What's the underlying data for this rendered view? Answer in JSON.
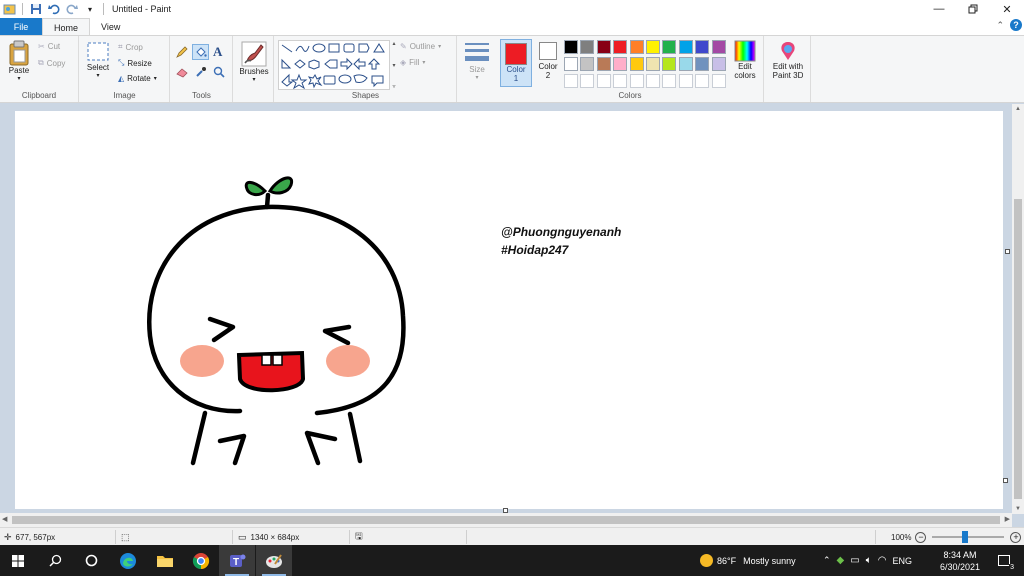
{
  "window": {
    "title": "Untitled - Paint",
    "minimize_icon": "minimize-icon",
    "maximize_icon": "restore-icon",
    "close_icon": "close-icon"
  },
  "tabs": [
    {
      "label": "File"
    },
    {
      "label": "Home"
    },
    {
      "label": "View"
    }
  ],
  "ribbon": {
    "clipboard": {
      "group_label": "Clipboard",
      "paste": "Paste",
      "cut": "Cut",
      "copy": "Copy"
    },
    "image": {
      "group_label": "Image",
      "select": "Select",
      "crop": "Crop",
      "resize": "Resize",
      "rotate": "Rotate"
    },
    "tools": {
      "group_label": "Tools"
    },
    "brushes": {
      "label": "Brushes"
    },
    "shapes": {
      "group_label": "Shapes",
      "outline": "Outline",
      "fill": "Fill"
    },
    "size": {
      "label": "Size"
    },
    "colors": {
      "group_label": "Colors",
      "color1_label": "Color\n1",
      "color1_label_a": "Color",
      "color1_label_b": "1",
      "color2_label_a": "Color",
      "color2_label_b": "2",
      "color1": "#ed1c24",
      "color2": "#ffffff",
      "edit_colors_a": "Edit",
      "edit_colors_b": "colors",
      "edit_3d_a": "Edit with",
      "edit_3d_b": "Paint 3D",
      "palette": [
        "#000000",
        "#7f7f7f",
        "#880015",
        "#ed1c24",
        "#ff7f27",
        "#fff200",
        "#22b14c",
        "#00a2e8",
        "#3f48cc",
        "#a349a4",
        "#ffffff",
        "#c3c3c3",
        "#b97a57",
        "#ffaec9",
        "#ffc90e",
        "#efe4b0",
        "#b5e61d",
        "#99d9ea",
        "#7092be",
        "#c8bfe7"
      ]
    }
  },
  "canvas": {
    "text_line1": "@Phuongnguyenanh",
    "text_line2": "#Hoidap247"
  },
  "status": {
    "cursor_pos": "677, 567px",
    "canvas_size": "1340 × 684px",
    "zoom": "100%"
  },
  "taskbar": {
    "weather_temp": "86°F",
    "weather_desc": "Mostly sunny",
    "lang": "ENG",
    "time": "8:34 AM",
    "date": "6/30/2021",
    "notif_count": "3"
  }
}
